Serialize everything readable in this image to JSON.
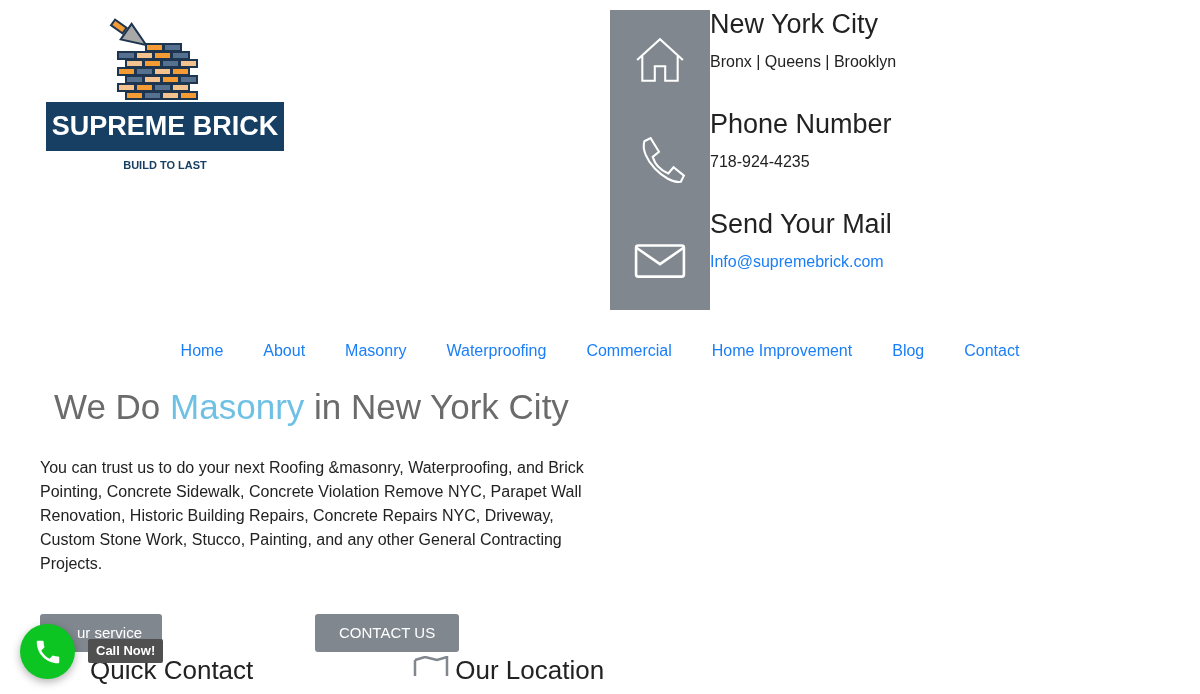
{
  "logo": {
    "title": "SUPREME BRICK",
    "tagline": "BUILD TO LAST"
  },
  "contacts": [
    {
      "kind": "home",
      "heading": "New York City",
      "text": "Bronx | Queens | Brooklyn"
    },
    {
      "kind": "phone",
      "heading": "Phone Number",
      "text": "718-924-4235"
    },
    {
      "kind": "mail",
      "heading": "Send Your Mail",
      "link": "Info@supremebrick.com"
    }
  ],
  "nav": [
    "Home",
    "About",
    "Masonry",
    "Waterproofing",
    "Commercial",
    "Home Improvement",
    "Blog",
    "Contact"
  ],
  "hero": {
    "heading": [
      {
        "text": "We Do",
        "highlight": false
      },
      {
        "text": "Masonry",
        "highlight": true
      },
      {
        "text": "in New York City",
        "highlight": false
      }
    ],
    "paragraph": "You can trust us to do your next Roofing &masonry, Waterproofing, and Brick Pointing, Concrete Sidewalk, Concrete Violation Remove NYC, Parapet Wall Renovation, Historic Building Repairs, Concrete Repairs NYC, Driveway, Custom Stone Work, Stucco, Painting, and any other General Contracting Projects.",
    "buttons": [
      "ur service",
      "CONTACT US"
    ]
  },
  "sections": [
    {
      "kind": "plain",
      "heading": "Quick Contact"
    },
    {
      "kind": "map",
      "heading": "Our Location"
    }
  ],
  "call_button": {
    "label": "Call Now!"
  }
}
